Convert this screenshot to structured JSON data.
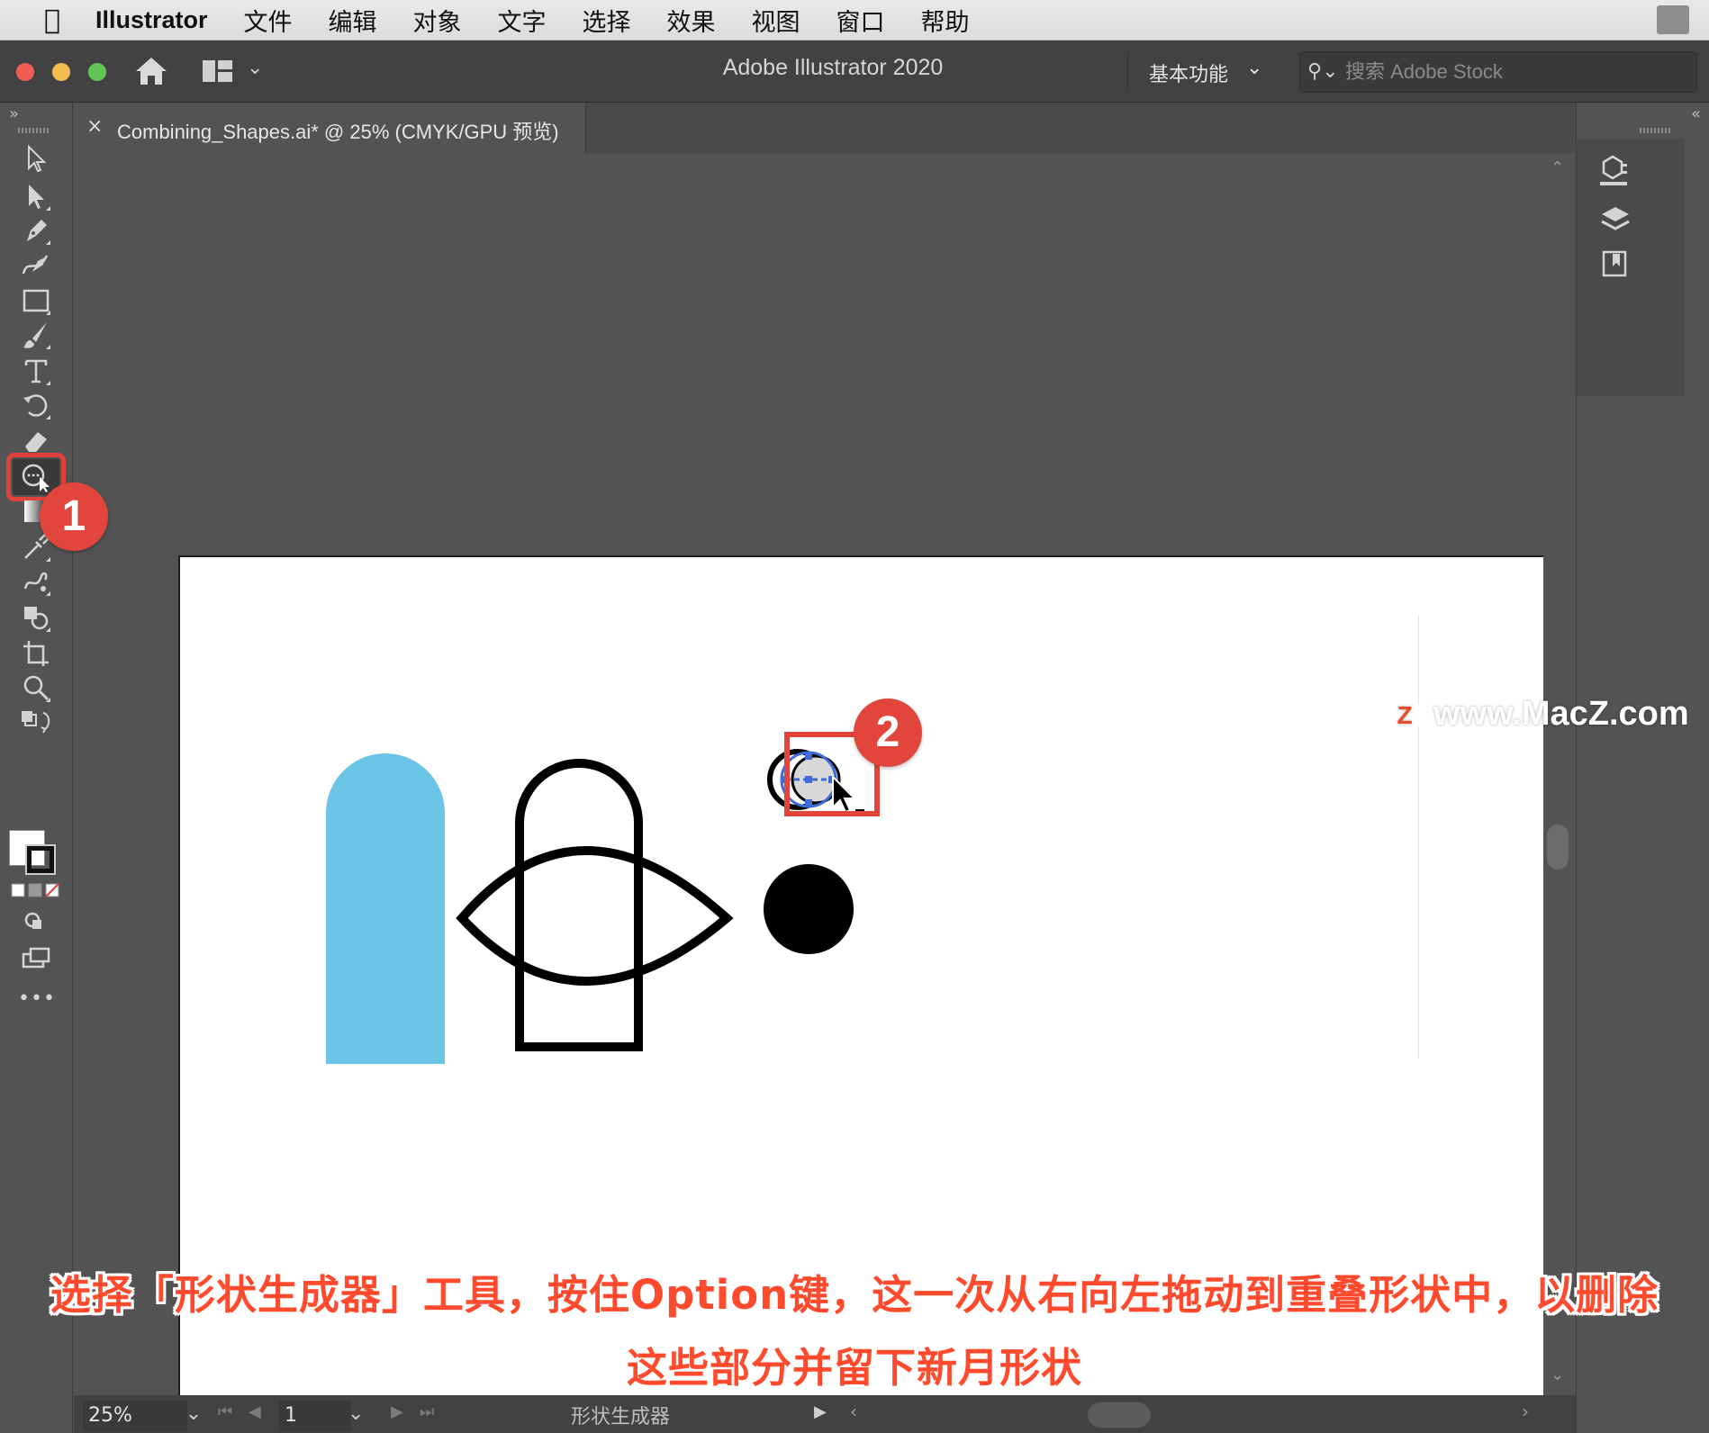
{
  "menubar": {
    "app_name": "Illustrator",
    "items": [
      "文件",
      "编辑",
      "对象",
      "文字",
      "选择",
      "效果",
      "视图",
      "窗口",
      "帮助"
    ]
  },
  "titlebar": {
    "title": "Adobe Illustrator 2020",
    "workspace": "基本功能",
    "search_placeholder": "搜索 Adobe Stock"
  },
  "document_tab": {
    "close": "×",
    "name": "Combining_Shapes.ai* @ 25% (CMYK/GPU 预览)"
  },
  "toolbar": {
    "selected_tool": "shape-builder-tool",
    "more": "•••"
  },
  "artwork": {
    "blue_shape_color": "#6ac5e6",
    "stroke_color": "#000000"
  },
  "status": {
    "zoom": "25%",
    "page": "1",
    "tool_name": "形状生成器"
  },
  "annotations": {
    "badge_1": "1",
    "badge_2": "2",
    "accent_color": "#e2453c"
  },
  "caption": {
    "line1": "选择「形状生成器」工具，按住Option键，这一次从右向左拖动到重叠形状中，以删除",
    "line2": "这些部分并留下新月形状"
  },
  "watermark": {
    "logo": "Z",
    "text": "www.MacZ.com"
  }
}
